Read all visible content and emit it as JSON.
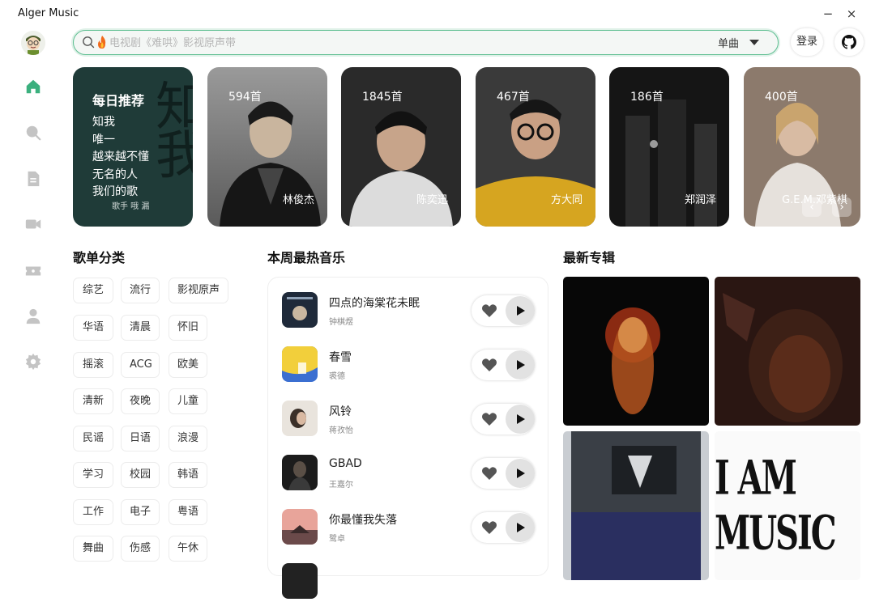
{
  "app": {
    "title": "Alger Music",
    "minimize": "−",
    "close": "×"
  },
  "search": {
    "placeholder": "电视剧《难哄》影视原声带",
    "type_label": "单曲"
  },
  "header": {
    "login_label": "登录"
  },
  "daily": {
    "title": "每日推荐",
    "items": [
      "知我",
      "唯一",
      "越来越不懂",
      "无名的人",
      "我们的歌"
    ],
    "deco": "知我",
    "singer": "歌手 哦 漏"
  },
  "artists": [
    {
      "count": "594首",
      "name": "林俊杰",
      "bg": "#6f6f6f"
    },
    {
      "count": "1845首",
      "name": "陈奕迅",
      "bg": "#2b2b2b"
    },
    {
      "count": "467首",
      "name": "方大同",
      "bg": "#5b4a33"
    },
    {
      "count": "186首",
      "name": "郑润泽",
      "bg": "#1c1c1c"
    },
    {
      "count": "400首",
      "name": "G.E.M.邓紫棋",
      "bg": "#8b7767"
    }
  ],
  "carousel": {
    "prev": "‹",
    "next": "›"
  },
  "sections": {
    "categories": "歌单分类",
    "hot": "本周最热音乐",
    "albums": "最新专辑"
  },
  "categories": [
    [
      "综艺",
      "流行",
      "影视原声"
    ],
    [
      "华语",
      "清晨",
      "怀旧"
    ],
    [
      "摇滚",
      "ACG",
      "欧美"
    ],
    [
      "清新",
      "夜晚",
      "儿童"
    ],
    [
      "民谣",
      "日语",
      "浪漫"
    ],
    [
      "学习",
      "校园",
      "韩语"
    ],
    [
      "工作",
      "电子",
      "粤语"
    ],
    [
      "舞曲",
      "伤感",
      "午休"
    ]
  ],
  "hot_songs": [
    {
      "title": "四点的海棠花未眠",
      "artist": "钟棋煜"
    },
    {
      "title": "春雪",
      "artist": "裘德"
    },
    {
      "title": "风铃",
      "artist": "蒋孜怡"
    },
    {
      "title": "GBAD",
      "artist": "王嘉尔"
    },
    {
      "title": "你最懂我失落",
      "artist": "鹭卓"
    }
  ],
  "albums": [
    {
      "text": ""
    },
    {
      "text": ""
    },
    {
      "text": ""
    },
    {
      "text": "I AM MUSIC"
    }
  ],
  "colors": {
    "accent": "#3bb07e",
    "search_border": "#5fbf92"
  }
}
